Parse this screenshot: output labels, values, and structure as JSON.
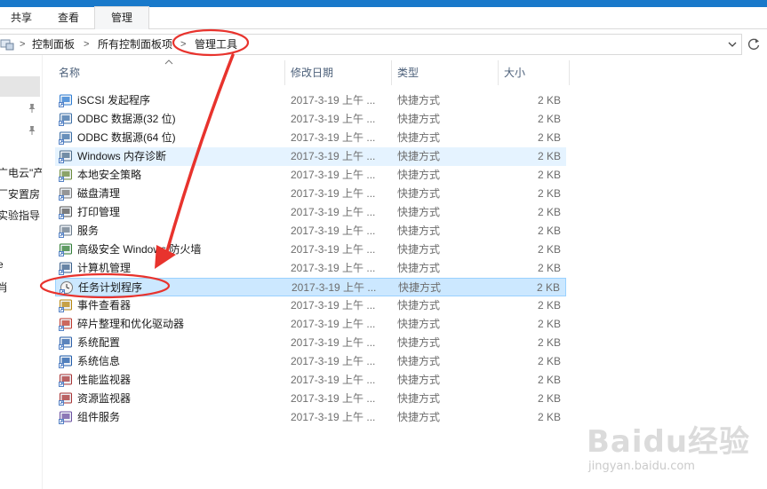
{
  "ribbon": {
    "tabs": [
      "共享",
      "查看",
      "管理"
    ],
    "active_tab": "管理"
  },
  "address": {
    "crumbs": [
      "控制面板",
      "所有控制面板项",
      "管理工具"
    ],
    "separator": ">",
    "dropdown_icon": "chevron-down-icon",
    "refresh_icon": "refresh-icon"
  },
  "sidebar": {
    "items": [
      "广电云\"产",
      "厂安置房",
      "实验指导",
      "e",
      "肖"
    ]
  },
  "columns": {
    "name": "名称",
    "date": "修改日期",
    "type": "类型",
    "size": "大小"
  },
  "files": [
    {
      "name": "iSCSI 发起程序",
      "date": "2017-3-19 上午 ...",
      "type": "快捷方式",
      "size": "2 KB",
      "icon": "iscsi-icon",
      "color": "#2a7ad1"
    },
    {
      "name": "ODBC 数据源(32 位)",
      "date": "2017-3-19 上午 ...",
      "type": "快捷方式",
      "size": "2 KB",
      "icon": "odbc-icon",
      "color": "#3b6ea5"
    },
    {
      "name": "ODBC 数据源(64 位)",
      "date": "2017-3-19 上午 ...",
      "type": "快捷方式",
      "size": "2 KB",
      "icon": "odbc-icon",
      "color": "#3b6ea5"
    },
    {
      "name": "Windows 内存诊断",
      "date": "2017-3-19 上午 ...",
      "type": "快捷方式",
      "size": "2 KB",
      "icon": "memory-diagnostic-icon",
      "color": "#4a6b8a"
    },
    {
      "name": "本地安全策略",
      "date": "2017-3-19 上午 ...",
      "type": "快捷方式",
      "size": "2 KB",
      "icon": "security-policy-icon",
      "color": "#6a8a3a"
    },
    {
      "name": "磁盘清理",
      "date": "2017-3-19 上午 ...",
      "type": "快捷方式",
      "size": "2 KB",
      "icon": "disk-cleanup-icon",
      "color": "#777777"
    },
    {
      "name": "打印管理",
      "date": "2017-3-19 上午 ...",
      "type": "快捷方式",
      "size": "2 KB",
      "icon": "printer-icon",
      "color": "#555555"
    },
    {
      "name": "服务",
      "date": "2017-3-19 上午 ...",
      "type": "快捷方式",
      "size": "2 KB",
      "icon": "services-gear-icon",
      "color": "#6a7a8a"
    },
    {
      "name": "高级安全 Windows 防火墙",
      "date": "2017-3-19 上午 ...",
      "type": "快捷方式",
      "size": "2 KB",
      "icon": "firewall-icon",
      "color": "#2f7d32"
    },
    {
      "name": "计算机管理",
      "date": "2017-3-19 上午 ...",
      "type": "快捷方式",
      "size": "2 KB",
      "icon": "computer-management-icon",
      "color": "#3a5f8a"
    },
    {
      "name": "任务计划程序",
      "date": "2017-3-19 上午 ...",
      "type": "快捷方式",
      "size": "2 KB",
      "icon": "task-scheduler-clock-icon",
      "color": "#8a8a8a"
    },
    {
      "name": "事件查看器",
      "date": "2017-3-19 上午 ...",
      "type": "快捷方式",
      "size": "2 KB",
      "icon": "event-viewer-icon",
      "color": "#b8860b"
    },
    {
      "name": "碎片整理和优化驱动器",
      "date": "2017-3-19 上午 ...",
      "type": "快捷方式",
      "size": "2 KB",
      "icon": "defrag-icon",
      "color": "#c0392b"
    },
    {
      "name": "系统配置",
      "date": "2017-3-19 上午 ...",
      "type": "快捷方式",
      "size": "2 KB",
      "icon": "system-config-icon",
      "color": "#2b5fa8"
    },
    {
      "name": "系统信息",
      "date": "2017-3-19 上午 ...",
      "type": "快捷方式",
      "size": "2 KB",
      "icon": "system-info-icon",
      "color": "#1e5aa8"
    },
    {
      "name": "性能监视器",
      "date": "2017-3-19 上午 ...",
      "type": "快捷方式",
      "size": "2 KB",
      "icon": "performance-monitor-icon",
      "color": "#a83232"
    },
    {
      "name": "资源监视器",
      "date": "2017-3-19 上午 ...",
      "type": "快捷方式",
      "size": "2 KB",
      "icon": "resource-monitor-icon",
      "color": "#a83232"
    },
    {
      "name": "组件服务",
      "date": "2017-3-19 上午 ...",
      "type": "快捷方式",
      "size": "2 KB",
      "icon": "component-services-icon",
      "color": "#6b4fa0"
    }
  ],
  "hovered_file": "Windows 内存诊断",
  "selected_file": "任务计划程序",
  "annotation_color": "#e8332d",
  "watermark": {
    "brand": "Baidu经验",
    "url": "jingyan.baidu.com"
  }
}
